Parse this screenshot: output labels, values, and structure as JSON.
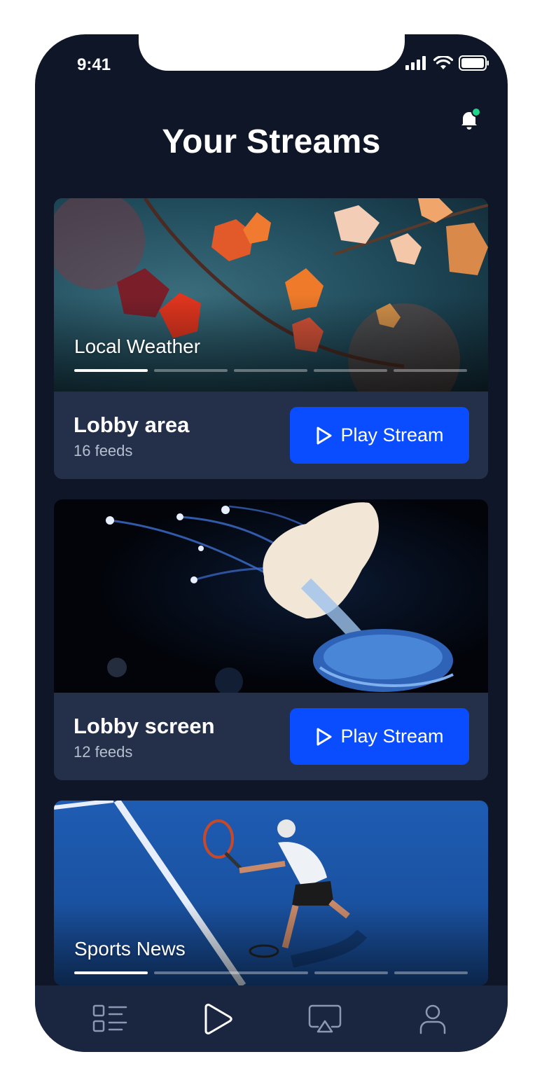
{
  "status_bar": {
    "time": "9:41"
  },
  "header": {
    "title": "Your Streams"
  },
  "colors": {
    "accent": "#0a4cff",
    "background": "#0e1628",
    "card": "#243049",
    "notification_dot": "#1ed68a"
  },
  "cards": [
    {
      "media_label": "Local Weather",
      "progress_segments": 5,
      "active_segment": 1,
      "title": "Lobby area",
      "subtitle": "16 feeds",
      "button_label": "Play Stream"
    },
    {
      "title": "Lobby screen",
      "subtitle": "12 feeds",
      "button_label": "Play Stream"
    },
    {
      "media_label": "Sports News",
      "progress_segments": 5,
      "active_segment": 1
    }
  ],
  "tabbar": {
    "items": [
      {
        "icon": "list-icon"
      },
      {
        "icon": "play-icon"
      },
      {
        "icon": "airplay-icon"
      },
      {
        "icon": "user-icon"
      }
    ]
  }
}
